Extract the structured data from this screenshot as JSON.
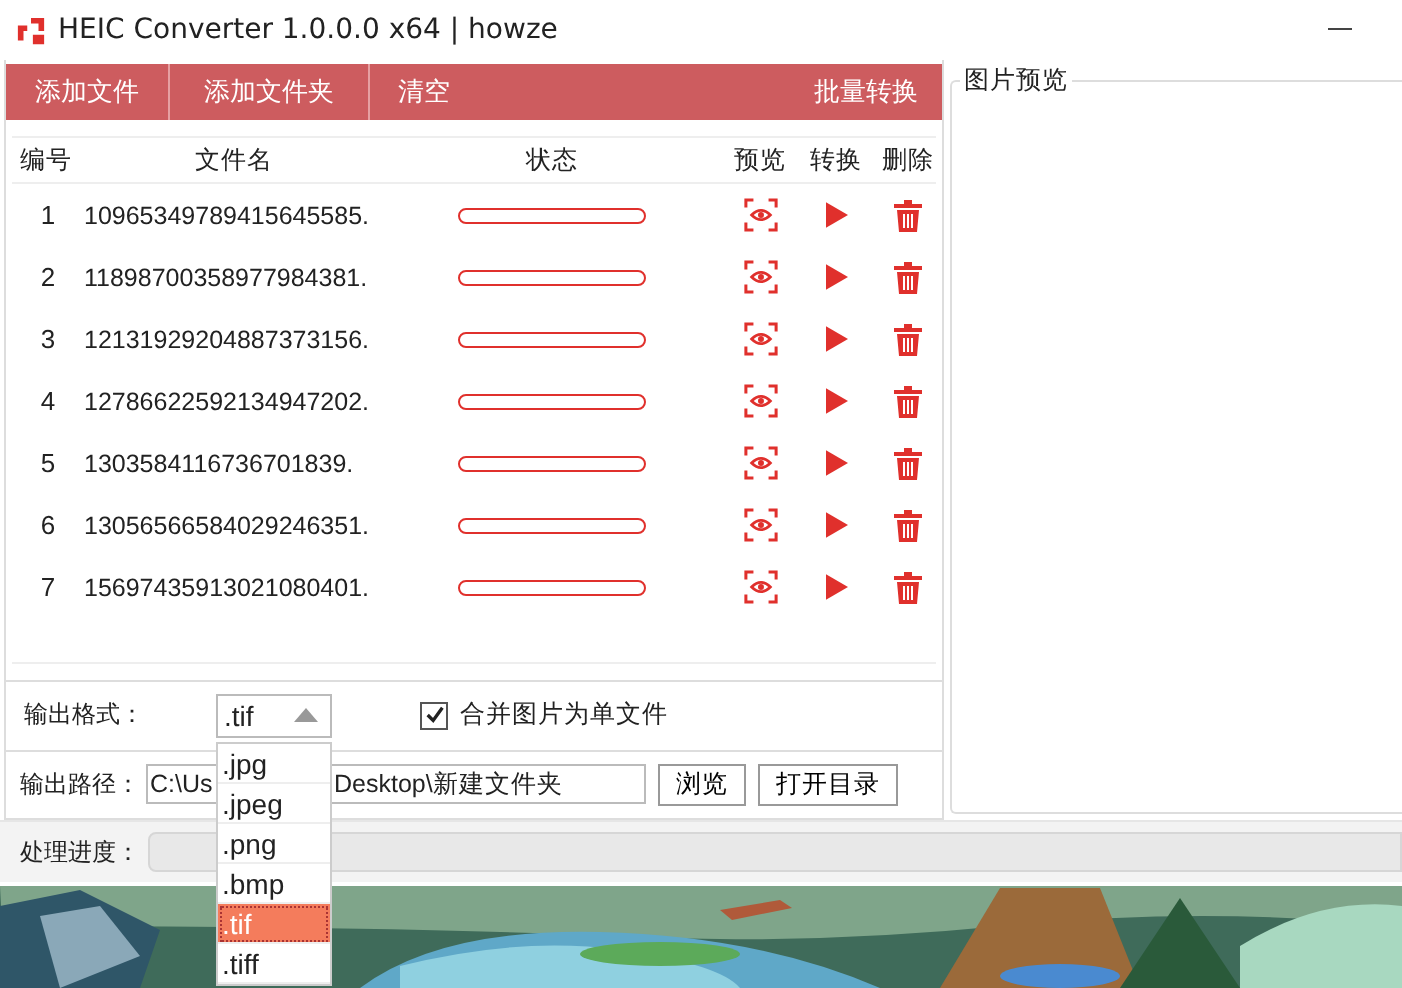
{
  "window": {
    "title": "HEIC Converter 1.0.0.0 x64 | howze"
  },
  "toolbar": {
    "buttons": [
      "添加文件",
      "添加文件夹",
      "清空"
    ],
    "batch_button": "批量转换"
  },
  "table": {
    "columns": [
      "编号",
      "文件名",
      "状态",
      "预览",
      "转换",
      "删除"
    ],
    "rows": [
      {
        "number": "1",
        "filename": "10965349789415645585.",
        "level": 0
      },
      {
        "number": "2",
        "filename": "11898700358977984381.",
        "level": 0
      },
      {
        "number": "3",
        "filename": "12131929204887373156.",
        "level": 0
      },
      {
        "number": "4",
        "filename": "12786622592134947202.",
        "level": 0
      },
      {
        "number": "5",
        "filename": "1303584116736701839.",
        "level": 0
      },
      {
        "number": "6",
        "filename": "13056566584029246351.",
        "level": 0
      },
      {
        "number": "7",
        "filename": "15697435913021080401.",
        "level": 0
      }
    ]
  },
  "output_format": {
    "label": "输出格式：",
    "value": ".tif",
    "expanded": true,
    "options": [
      {
        "label": ".jpg",
        "selected": false
      },
      {
        "label": ".jpeg",
        "selected": false
      },
      {
        "label": ".png",
        "selected": false
      },
      {
        "label": ".bmp",
        "selected": false
      },
      {
        "label": ".tif",
        "selected": true
      },
      {
        "label": ".tiff",
        "selected": false
      }
    ]
  },
  "merge_checkbox": {
    "label": "合并图片为单文件",
    "checked": true
  },
  "output_path": {
    "label": "输出路径：",
    "value_parts": [
      "C:\\Us",
      "Desktop\\新建文件夹"
    ],
    "buttons": [
      "浏览",
      "打开目录"
    ]
  },
  "progress": {
    "label": "处理进度：",
    "level": 0
  },
  "preview_panel": {
    "title": "图片预览"
  }
}
